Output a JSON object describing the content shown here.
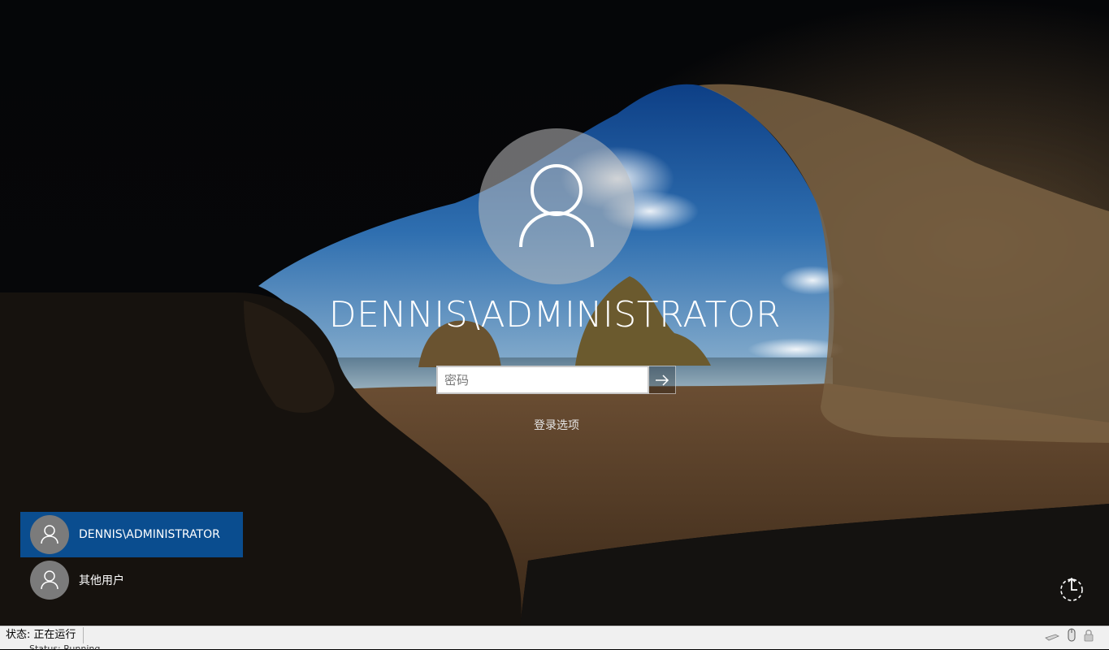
{
  "lock_screen": {
    "username": "DENNIS\\ADMINISTRATOR",
    "password_placeholder": "密码",
    "signin_options": "登录选项"
  },
  "user_list": [
    {
      "label": "DENNIS\\ADMINISTRATOR",
      "selected": true
    },
    {
      "label": "其他用户",
      "selected": false
    }
  ],
  "status_bar": {
    "label": "状态:",
    "value": "正在运行",
    "secondary_text": "Status: Running"
  },
  "icons": {
    "avatar": "user-silhouette-icon",
    "submit": "arrow-right-icon",
    "power": "power-ease-of-access-icon",
    "tray": [
      "keyboard-icon",
      "mouse-icon",
      "lock-icon"
    ]
  },
  "colors": {
    "selected_tile": "#0a4d8f",
    "avatar_circle": "#bebebe",
    "statusbar_bg": "#f0f0f0"
  }
}
